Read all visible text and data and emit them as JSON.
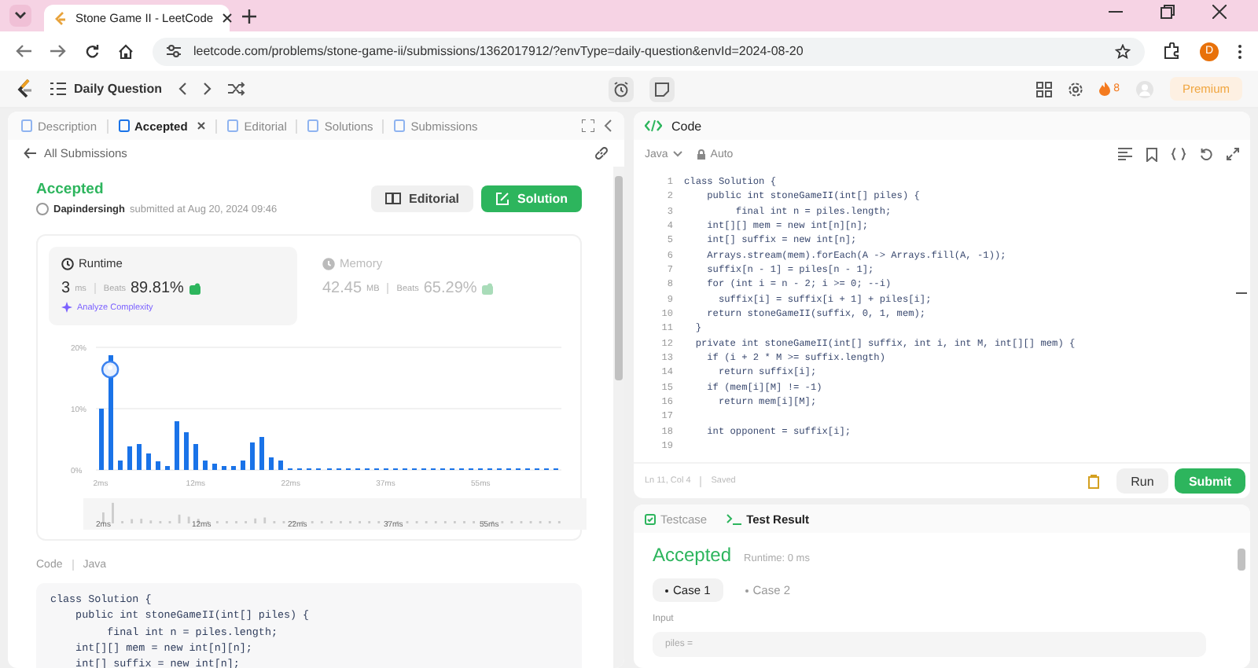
{
  "browser": {
    "tab_title": "Stone Game II - LeetCode",
    "url": "leetcode.com/problems/stone-game-ii/submissions/1362017912/?envType=daily-question&envId=2024-08-20",
    "profile_initial": "D"
  },
  "nav": {
    "title": "Daily Question",
    "streak": "8",
    "premium": "Premium"
  },
  "left_panel": {
    "tabs": [
      {
        "label": "Description",
        "selected": false,
        "closable": false
      },
      {
        "label": "Accepted",
        "selected": true,
        "closable": true
      },
      {
        "label": "Editorial",
        "selected": false,
        "closable": false
      },
      {
        "label": "Solutions",
        "selected": false,
        "closable": false
      },
      {
        "label": "Submissions",
        "selected": false,
        "closable": false
      }
    ],
    "back_link": "All Submissions",
    "submission": {
      "status": "Accepted",
      "user": "Dapindersingh",
      "submitted_text": "submitted at Aug 20, 2024 09:46"
    },
    "buttons": [
      {
        "label": "Editorial",
        "kind": "secondary"
      },
      {
        "label": "Solution",
        "kind": "primary"
      }
    ],
    "stats": [
      {
        "title": "Runtime",
        "value": "3",
        "unit": "ms",
        "beats_label": "Beats",
        "beats": "89.81%",
        "selected": true,
        "link": "Analyze Complexity"
      },
      {
        "title": "Memory",
        "value": "42.45",
        "unit": "MB",
        "beats_label": "Beats",
        "beats": "65.29%",
        "selected": false
      }
    ],
    "chart_data": {
      "type": "bar",
      "categories": [
        "2ms",
        null,
        null,
        null,
        null,
        null,
        null,
        null,
        null,
        null,
        "12ms",
        null,
        null,
        null,
        null,
        null,
        null,
        null,
        null,
        null,
        "22ms",
        null,
        null,
        null,
        null,
        null,
        null,
        null,
        null,
        null,
        "37ms",
        null,
        null,
        null,
        null,
        null,
        null,
        null,
        null,
        null,
        "55ms",
        null,
        null,
        null,
        null,
        null,
        null,
        null,
        null
      ],
      "values": [
        10,
        18.7,
        1.6,
        3.9,
        4.2,
        2.7,
        1.4,
        0.6,
        8,
        6.1,
        4.2,
        1.6,
        1,
        0.6,
        0.6,
        1.6,
        4.5,
        5.4,
        2,
        1.6,
        0.3,
        0.3,
        0.3,
        0.3,
        0.3,
        0.3,
        0.3,
        0.3,
        0.3,
        0.3,
        0.3,
        0.3,
        0.3,
        0.3,
        0.3,
        0.3,
        0.3,
        0.3,
        0.3,
        0.3,
        0.3,
        0.3,
        0.3,
        0.3,
        0.3,
        0.3,
        0.3,
        0.3,
        0.3
      ],
      "ylim": [
        0,
        20
      ],
      "yticks": [
        {
          "value": 0,
          "label": "0%"
        },
        {
          "value": 10,
          "label": "10%"
        },
        {
          "value": 20,
          "label": "20%"
        }
      ],
      "relative": false
    },
    "navigator_labels": [
      "2ms",
      "12ms",
      "22ms",
      "37ms",
      "55ms"
    ],
    "code_label": "Code",
    "code_language": "Java",
    "code_lines": [
      "class Solution {",
      "    public int stoneGameII(int[] piles) {",
      "         final int n = piles.length;",
      "    int[][] mem = new int[n][n];",
      "    int[] suffix = new int[n];"
    ]
  },
  "right_panel": {
    "title": "Code",
    "language": "Java",
    "mode": "Auto",
    "editor_lines": [
      {
        "number": "1",
        "code": "class Solution {"
      },
      {
        "number": "2",
        "code": "    public int stoneGameII(int[] piles) {"
      },
      {
        "number": "3",
        "code": "         final int n = piles.length;"
      },
      {
        "number": "4",
        "code": "    int[][] mem = new int[n][n];"
      },
      {
        "number": "5",
        "code": "    int[] suffix = new int[n];"
      },
      {
        "number": "6",
        "code": "    Arrays.stream(mem).forEach(A -> Arrays.fill(A, -1));"
      },
      {
        "number": "7",
        "code": "    suffix[n - 1] = piles[n - 1];"
      },
      {
        "number": "8",
        "code": "    for (int i = n - 2; i >= 0; --i)"
      },
      {
        "number": "9",
        "code": "      suffix[i] = suffix[i + 1] + piles[i];"
      },
      {
        "number": "10",
        "code": "    return stoneGameII(suffix, 0, 1, mem);"
      },
      {
        "number": "11",
        "code": "  }"
      },
      {
        "number": "12",
        "code": "  private int stoneGameII(int[] suffix, int i, int M, int[][] mem) {"
      },
      {
        "number": "13",
        "code": "    if (i + 2 * M >= suffix.length)"
      },
      {
        "number": "14",
        "code": "      return suffix[i];"
      },
      {
        "number": "15",
        "code": "    if (mem[i][M] != -1)"
      },
      {
        "number": "16",
        "code": "      return mem[i][M];"
      },
      {
        "number": "17"
      },
      {
        "number": "18",
        "code": "    int opponent = suffix[i];"
      },
      {
        "number": "19"
      }
    ],
    "cursor": "Ln 11, Col 4",
    "save_state": "Saved",
    "run": "Run",
    "submit": "Submit",
    "result_tabs": [
      {
        "label": "Testcase",
        "selected": false
      },
      {
        "label": "Test Result",
        "selected": true
      }
    ],
    "result": {
      "status": "Accepted",
      "runtime": "Runtime: 0 ms"
    },
    "cases": [
      {
        "label": "Case 1",
        "selected": true
      },
      {
        "label": "Case 2",
        "selected": false
      }
    ],
    "input_label": "Input",
    "input_value": "piles ="
  }
}
